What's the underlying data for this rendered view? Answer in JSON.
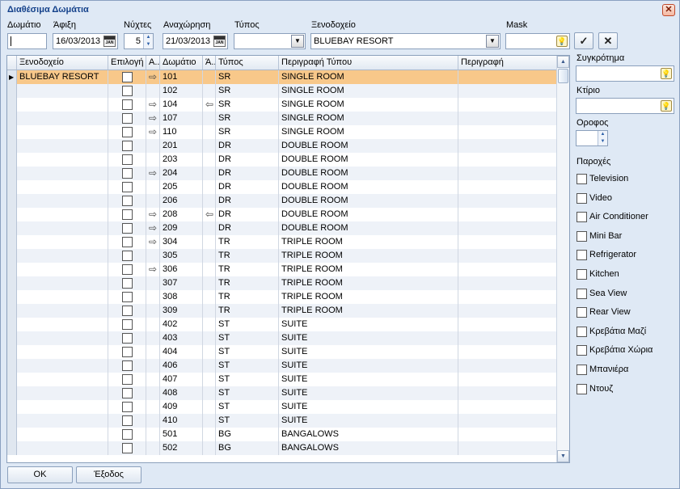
{
  "window": {
    "title": "Διαθέσιμα Δωμάτια",
    "close_glyph": "✕"
  },
  "filters": {
    "room_label": "Δωμάτιο",
    "room_value": "",
    "arrival_label": "Άφιξη",
    "arrival_value": "16/03/2013",
    "nights_label": "Νύχτες",
    "nights_value": "5",
    "departure_label": "Αναχώρηση",
    "departure_value": "21/03/2013",
    "type_label": "Τύπος",
    "type_value": "",
    "hotel_label": "Ξενοδοχείο",
    "hotel_value": "BLUEBAY RESORT",
    "mask_label": "Mask",
    "mask_value": "",
    "ok_glyph": "✓",
    "cancel_glyph": "✕"
  },
  "grid": {
    "headers": [
      "Ξενοδοχείο",
      "Επιλογή",
      "Α...",
      "Δωμάτιο",
      "Ά...",
      "Τύπος",
      "Περιγραφή Τύπου",
      "Περιγραφή"
    ],
    "rows": [
      {
        "hotel": "BLUEBAY RESORT",
        "a1": "⇨",
        "room": "101",
        "a2": "",
        "type": "SR",
        "desc": "SINGLE ROOM"
      },
      {
        "hotel": "",
        "a1": "",
        "room": "102",
        "a2": "",
        "type": "SR",
        "desc": "SINGLE ROOM"
      },
      {
        "hotel": "",
        "a1": "⇨",
        "room": "104",
        "a2": "⇦",
        "type": "SR",
        "desc": "SINGLE ROOM"
      },
      {
        "hotel": "",
        "a1": "⇨",
        "room": "107",
        "a2": "",
        "type": "SR",
        "desc": "SINGLE ROOM"
      },
      {
        "hotel": "",
        "a1": "⇨",
        "room": "110",
        "a2": "",
        "type": "SR",
        "desc": "SINGLE ROOM"
      },
      {
        "hotel": "",
        "a1": "",
        "room": "201",
        "a2": "",
        "type": "DR",
        "desc": "DOUBLE ROOM"
      },
      {
        "hotel": "",
        "a1": "",
        "room": "203",
        "a2": "",
        "type": "DR",
        "desc": "DOUBLE ROOM"
      },
      {
        "hotel": "",
        "a1": "⇨",
        "room": "204",
        "a2": "",
        "type": "DR",
        "desc": "DOUBLE ROOM"
      },
      {
        "hotel": "",
        "a1": "",
        "room": "205",
        "a2": "",
        "type": "DR",
        "desc": "DOUBLE ROOM"
      },
      {
        "hotel": "",
        "a1": "",
        "room": "206",
        "a2": "",
        "type": "DR",
        "desc": "DOUBLE ROOM"
      },
      {
        "hotel": "",
        "a1": "⇨",
        "room": "208",
        "a2": "⇦",
        "type": "DR",
        "desc": "DOUBLE ROOM"
      },
      {
        "hotel": "",
        "a1": "⇨",
        "room": "209",
        "a2": "",
        "type": "DR",
        "desc": "DOUBLE ROOM"
      },
      {
        "hotel": "",
        "a1": "⇨",
        "room": "304",
        "a2": "",
        "type": "TR",
        "desc": "TRIPLE ROOM"
      },
      {
        "hotel": "",
        "a1": "",
        "room": "305",
        "a2": "",
        "type": "TR",
        "desc": "TRIPLE ROOM"
      },
      {
        "hotel": "",
        "a1": "⇨",
        "room": "306",
        "a2": "",
        "type": "TR",
        "desc": "TRIPLE ROOM"
      },
      {
        "hotel": "",
        "a1": "",
        "room": "307",
        "a2": "",
        "type": "TR",
        "desc": "TRIPLE ROOM"
      },
      {
        "hotel": "",
        "a1": "",
        "room": "308",
        "a2": "",
        "type": "TR",
        "desc": "TRIPLE ROOM"
      },
      {
        "hotel": "",
        "a1": "",
        "room": "309",
        "a2": "",
        "type": "TR",
        "desc": "TRIPLE ROOM"
      },
      {
        "hotel": "",
        "a1": "",
        "room": "402",
        "a2": "",
        "type": "ST",
        "desc": "SUITE"
      },
      {
        "hotel": "",
        "a1": "",
        "room": "403",
        "a2": "",
        "type": "ST",
        "desc": "SUITE"
      },
      {
        "hotel": "",
        "a1": "",
        "room": "404",
        "a2": "",
        "type": "ST",
        "desc": "SUITE"
      },
      {
        "hotel": "",
        "a1": "",
        "room": "406",
        "a2": "",
        "type": "ST",
        "desc": "SUITE"
      },
      {
        "hotel": "",
        "a1": "",
        "room": "407",
        "a2": "",
        "type": "ST",
        "desc": "SUITE"
      },
      {
        "hotel": "",
        "a1": "",
        "room": "408",
        "a2": "",
        "type": "ST",
        "desc": "SUITE"
      },
      {
        "hotel": "",
        "a1": "",
        "room": "409",
        "a2": "",
        "type": "ST",
        "desc": "SUITE"
      },
      {
        "hotel": "",
        "a1": "",
        "room": "410",
        "a2": "",
        "type": "ST",
        "desc": "SUITE"
      },
      {
        "hotel": "",
        "a1": "",
        "room": "501",
        "a2": "",
        "type": "BG",
        "desc": "BANGALOWS"
      },
      {
        "hotel": "",
        "a1": "",
        "room": "502",
        "a2": "",
        "type": "BG",
        "desc": "BANGALOWS"
      }
    ]
  },
  "side": {
    "complex_label": "Συγκρότημα",
    "complex_value": "",
    "building_label": "Κτίριο",
    "building_value": "",
    "floor_label": "Οροφος",
    "floor_value": "",
    "amenities_label": "Παροχές",
    "amenities": [
      "Television",
      "Video",
      "Air Conditioner",
      "Mini Bar",
      "Refrigerator",
      "Kitchen",
      "Sea View",
      "Rear View",
      "Κρεβάτια Μαζί",
      "Κρεβάτια Χώρια",
      "Μπανιέρα",
      "Ντουζ"
    ]
  },
  "buttons": {
    "ok_label": "OK",
    "exit_label": "Έξοδος"
  },
  "icons": {
    "selected_row_marker": "▶",
    "calendar_text": "JAN",
    "hint_icon": "lightbulb-icon"
  },
  "colors": {
    "selected_row": "#f8c88a",
    "alt_row": "#eef2f8",
    "title": "#15428b"
  }
}
